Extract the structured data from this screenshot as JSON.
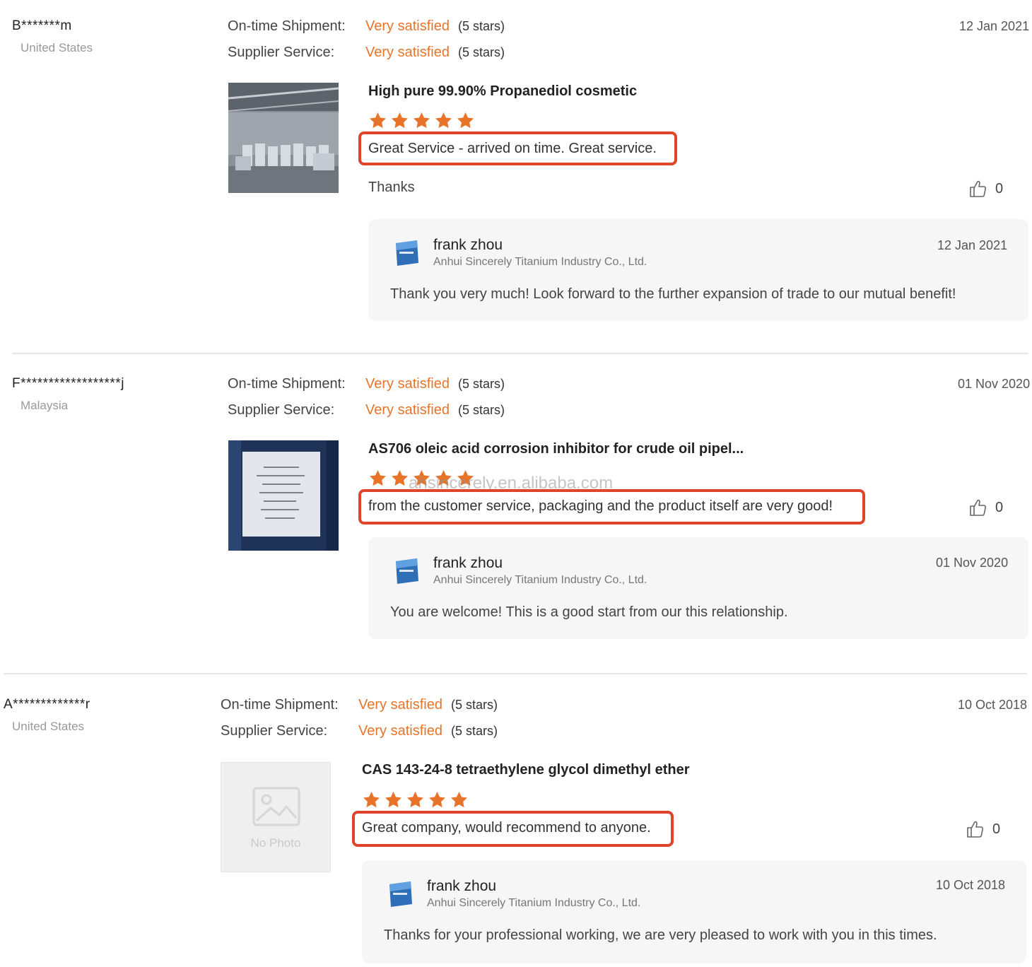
{
  "labels": {
    "ontime": "On-time Shipment:",
    "supplier": "Supplier Service:"
  },
  "colors": {
    "accent": "#e8742a",
    "highlight_border": "#e0452b",
    "star": "#e8742a",
    "reply_bg": "#f6f6f7"
  },
  "watermark": "ahsincerely.en.alibaba.com",
  "reviews": [
    {
      "reviewer": "B*******m",
      "country": "United States",
      "ontime_value": "Very satisfied",
      "ontime_stars": "(5 stars)",
      "supplier_value": "Very satisfied",
      "supplier_stars": "(5 stars)",
      "date": "12 Jan 2021",
      "product_title": "High pure 99.90% Propanediol cosmetic",
      "rating": 5,
      "comment": "Great Service - arrived on time. Great service.",
      "extra": "Thanks",
      "likes": "0",
      "reply": {
        "author": "frank zhou",
        "company": "Anhui Sincerely Titanium Industry Co., Ltd.",
        "date": "12 Jan 2021",
        "text": "Thank you very much! Look forward to the further expansion of trade to our mutual benefit!"
      }
    },
    {
      "reviewer": "F******************j",
      "country": "Malaysia",
      "ontime_value": "Very satisfied",
      "ontime_stars": "(5 stars)",
      "supplier_value": "Very satisfied",
      "supplier_stars": "(5 stars)",
      "date": "01 Nov 2020",
      "product_title": "AS706 oleic acid corrosion inhibitor for crude oil pipel...",
      "rating": 5,
      "comment": "from the customer service, packaging and the product itself are very good!",
      "likes": "0",
      "reply": {
        "author": "frank zhou",
        "company": "Anhui Sincerely Titanium Industry Co., Ltd.",
        "date": "01 Nov 2020",
        "text": "You are welcome! This is a good start from our this relationship."
      }
    },
    {
      "reviewer": "A*************r",
      "country": "United States",
      "ontime_value": "Very satisfied",
      "ontime_stars": "(5 stars)",
      "supplier_value": "Very satisfied",
      "supplier_stars": "(5 stars)",
      "date": "10 Oct 2018",
      "product_title": "CAS 143-24-8 tetraethylene glycol dimethyl ether",
      "no_photo_label": "No Photo",
      "rating": 5,
      "comment": "Great company, would recommend to anyone.",
      "likes": "0",
      "reply": {
        "author": "frank zhou",
        "company": "Anhui Sincerely Titanium Industry Co., Ltd.",
        "date": "10 Oct 2018",
        "text": "Thanks for your professional  working, we are very pleased to work with you in this times."
      }
    }
  ]
}
